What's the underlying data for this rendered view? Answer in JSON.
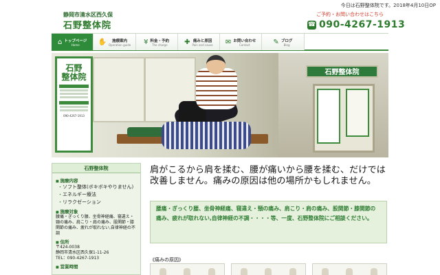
{
  "header": {
    "city": "静岡市清水区西久保",
    "clinic_name": "石野整体院",
    "open_notice": "今日は石野整体院です。2018年4月10日OP",
    "contact_label": "ご予約・お問い合わせはこちら",
    "phone": "090-4267-1913"
  },
  "nav": {
    "items": [
      {
        "label": "トップページ",
        "sub": "Home",
        "icon": "home-icon"
      },
      {
        "label": "施療案内",
        "sub": "Operation guide",
        "icon": "hand-icon"
      },
      {
        "label": "料金・予約",
        "sub": "The charge",
        "icon": "yen-icon"
      },
      {
        "label": "痛みと原因",
        "sub": "Pain and cause",
        "icon": "bandage-icon"
      },
      {
        "label": "お問い合わせ",
        "sub": "Contact",
        "icon": "mail-icon"
      },
      {
        "label": "ブログ",
        "sub": "Blog",
        "icon": "pencil-icon"
      }
    ]
  },
  "hero": {
    "sign_title": "石野\n整体院",
    "shop_sign": "石野整体院",
    "sign_phone": "090-4267-1913"
  },
  "sidebar": {
    "title": "石野整体院",
    "sections": [
      {
        "heading": "施療内容",
        "items": [
          "ソフト整体(ボキボキやりません)",
          "エネルギー療法",
          "リラクゼーション"
        ]
      },
      {
        "heading": "施療対象",
        "text": "腰痛・ぎっくり腰、坐骨神経痛、寝違え・頸の痛み、肩こり・肩の痛み、股関節・膝関節の痛み、疲れが取れない,自律神経の不調"
      },
      {
        "heading": "住所",
        "text": "〒424-0038\n静岡市清水区西久保1-11-26\nTEL：090-4267-1913"
      },
      {
        "heading": "営業時間",
        "text": ""
      }
    ]
  },
  "main": {
    "headline": "肩がこるから肩を揉む、腰が痛いから腰を揉む、だけでは改善しません。痛みの原因は他の場所かもしれません。",
    "notice": "腰痛・ぎっくり腰、坐骨神経痛、寝違え・頸の痛み、肩こり・肩の痛み、股関節・膝関節の痛み、疲れが取れない,自律神経の不調・・・・等、一度、石野整体院にご相談ください。",
    "cause_heading": "《痛みの原因》"
  },
  "colors": {
    "accent": "#2e8b3a",
    "brand_green": "#2c7a2c",
    "contact_red": "#d03a2a",
    "notice_bg": "#e6f1dd"
  }
}
